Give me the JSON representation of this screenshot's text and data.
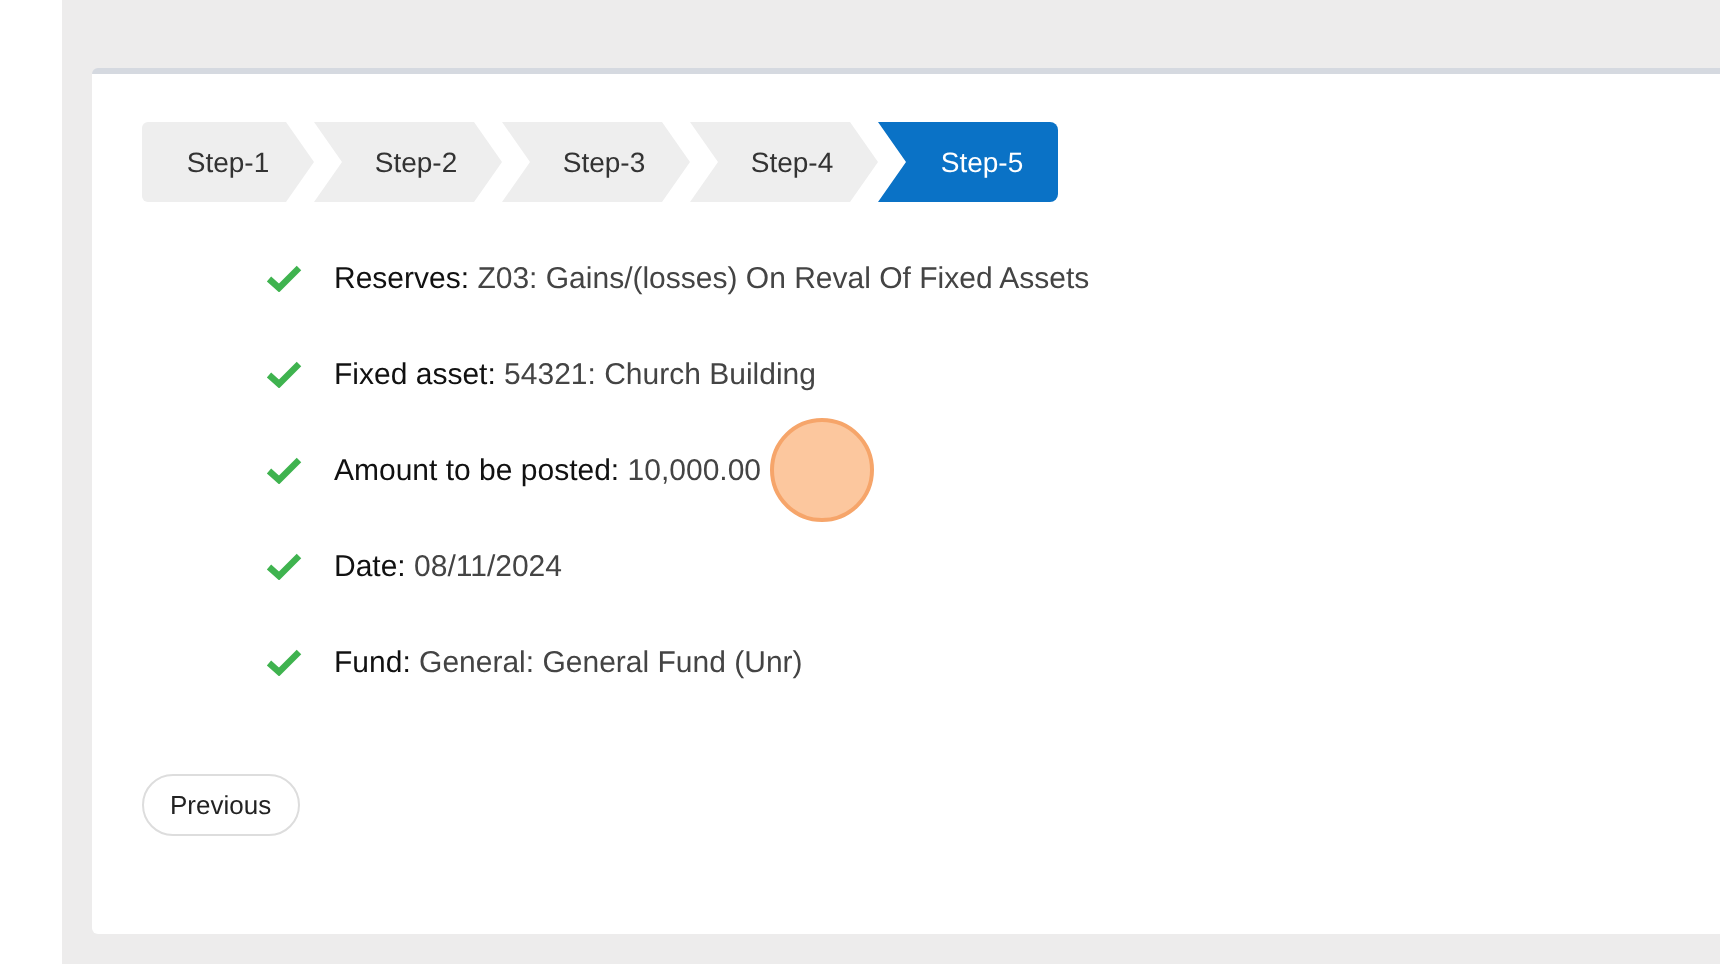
{
  "steps": [
    {
      "label": "Step-1",
      "selected": false
    },
    {
      "label": "Step-2",
      "selected": false
    },
    {
      "label": "Step-3",
      "selected": false
    },
    {
      "label": "Step-4",
      "selected": false
    },
    {
      "label": "Step-5",
      "selected": true
    }
  ],
  "summary": [
    {
      "label": "Reserves:",
      "value": "Z03: Gains/(losses) On Reval Of Fixed Assets"
    },
    {
      "label": "Fixed asset:",
      "value": "54321: Church Building"
    },
    {
      "label": "Amount to be posted:",
      "value": "10,000.00"
    },
    {
      "label": "Date:",
      "value": "08/11/2024"
    },
    {
      "label": "Fund:",
      "value": "General: General Fund (Unr)"
    }
  ],
  "buttons": [
    "Previous"
  ]
}
